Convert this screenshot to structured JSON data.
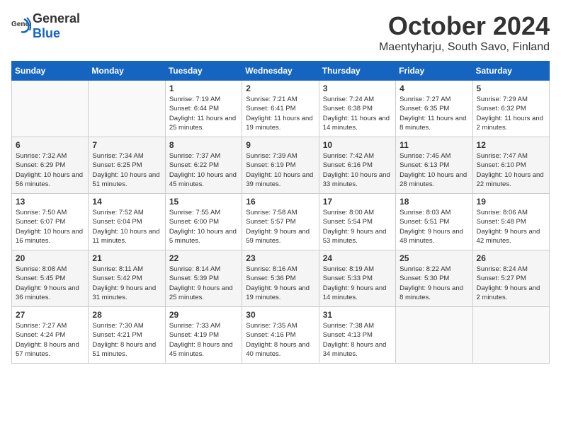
{
  "header": {
    "logo_general": "General",
    "logo_blue": "Blue",
    "month_title": "October 2024",
    "location": "Maentyharju, South Savo, Finland"
  },
  "weekdays": [
    "Sunday",
    "Monday",
    "Tuesday",
    "Wednesday",
    "Thursday",
    "Friday",
    "Saturday"
  ],
  "weeks": [
    [
      {
        "day": "",
        "sunrise": "",
        "sunset": "",
        "daylight": ""
      },
      {
        "day": "",
        "sunrise": "",
        "sunset": "",
        "daylight": ""
      },
      {
        "day": "1",
        "sunrise": "Sunrise: 7:19 AM",
        "sunset": "Sunset: 6:44 PM",
        "daylight": "Daylight: 11 hours and 25 minutes."
      },
      {
        "day": "2",
        "sunrise": "Sunrise: 7:21 AM",
        "sunset": "Sunset: 6:41 PM",
        "daylight": "Daylight: 11 hours and 19 minutes."
      },
      {
        "day": "3",
        "sunrise": "Sunrise: 7:24 AM",
        "sunset": "Sunset: 6:38 PM",
        "daylight": "Daylight: 11 hours and 14 minutes."
      },
      {
        "day": "4",
        "sunrise": "Sunrise: 7:27 AM",
        "sunset": "Sunset: 6:35 PM",
        "daylight": "Daylight: 11 hours and 8 minutes."
      },
      {
        "day": "5",
        "sunrise": "Sunrise: 7:29 AM",
        "sunset": "Sunset: 6:32 PM",
        "daylight": "Daylight: 11 hours and 2 minutes."
      }
    ],
    [
      {
        "day": "6",
        "sunrise": "Sunrise: 7:32 AM",
        "sunset": "Sunset: 6:29 PM",
        "daylight": "Daylight: 10 hours and 56 minutes."
      },
      {
        "day": "7",
        "sunrise": "Sunrise: 7:34 AM",
        "sunset": "Sunset: 6:25 PM",
        "daylight": "Daylight: 10 hours and 51 minutes."
      },
      {
        "day": "8",
        "sunrise": "Sunrise: 7:37 AM",
        "sunset": "Sunset: 6:22 PM",
        "daylight": "Daylight: 10 hours and 45 minutes."
      },
      {
        "day": "9",
        "sunrise": "Sunrise: 7:39 AM",
        "sunset": "Sunset: 6:19 PM",
        "daylight": "Daylight: 10 hours and 39 minutes."
      },
      {
        "day": "10",
        "sunrise": "Sunrise: 7:42 AM",
        "sunset": "Sunset: 6:16 PM",
        "daylight": "Daylight: 10 hours and 33 minutes."
      },
      {
        "day": "11",
        "sunrise": "Sunrise: 7:45 AM",
        "sunset": "Sunset: 6:13 PM",
        "daylight": "Daylight: 10 hours and 28 minutes."
      },
      {
        "day": "12",
        "sunrise": "Sunrise: 7:47 AM",
        "sunset": "Sunset: 6:10 PM",
        "daylight": "Daylight: 10 hours and 22 minutes."
      }
    ],
    [
      {
        "day": "13",
        "sunrise": "Sunrise: 7:50 AM",
        "sunset": "Sunset: 6:07 PM",
        "daylight": "Daylight: 10 hours and 16 minutes."
      },
      {
        "day": "14",
        "sunrise": "Sunrise: 7:52 AM",
        "sunset": "Sunset: 6:04 PM",
        "daylight": "Daylight: 10 hours and 11 minutes."
      },
      {
        "day": "15",
        "sunrise": "Sunrise: 7:55 AM",
        "sunset": "Sunset: 6:00 PM",
        "daylight": "Daylight: 10 hours and 5 minutes."
      },
      {
        "day": "16",
        "sunrise": "Sunrise: 7:58 AM",
        "sunset": "Sunset: 5:57 PM",
        "daylight": "Daylight: 9 hours and 59 minutes."
      },
      {
        "day": "17",
        "sunrise": "Sunrise: 8:00 AM",
        "sunset": "Sunset: 5:54 PM",
        "daylight": "Daylight: 9 hours and 53 minutes."
      },
      {
        "day": "18",
        "sunrise": "Sunrise: 8:03 AM",
        "sunset": "Sunset: 5:51 PM",
        "daylight": "Daylight: 9 hours and 48 minutes."
      },
      {
        "day": "19",
        "sunrise": "Sunrise: 8:06 AM",
        "sunset": "Sunset: 5:48 PM",
        "daylight": "Daylight: 9 hours and 42 minutes."
      }
    ],
    [
      {
        "day": "20",
        "sunrise": "Sunrise: 8:08 AM",
        "sunset": "Sunset: 5:45 PM",
        "daylight": "Daylight: 9 hours and 36 minutes."
      },
      {
        "day": "21",
        "sunrise": "Sunrise: 8:11 AM",
        "sunset": "Sunset: 5:42 PM",
        "daylight": "Daylight: 9 hours and 31 minutes."
      },
      {
        "day": "22",
        "sunrise": "Sunrise: 8:14 AM",
        "sunset": "Sunset: 5:39 PM",
        "daylight": "Daylight: 9 hours and 25 minutes."
      },
      {
        "day": "23",
        "sunrise": "Sunrise: 8:16 AM",
        "sunset": "Sunset: 5:36 PM",
        "daylight": "Daylight: 9 hours and 19 minutes."
      },
      {
        "day": "24",
        "sunrise": "Sunrise: 8:19 AM",
        "sunset": "Sunset: 5:33 PM",
        "daylight": "Daylight: 9 hours and 14 minutes."
      },
      {
        "day": "25",
        "sunrise": "Sunrise: 8:22 AM",
        "sunset": "Sunset: 5:30 PM",
        "daylight": "Daylight: 9 hours and 8 minutes."
      },
      {
        "day": "26",
        "sunrise": "Sunrise: 8:24 AM",
        "sunset": "Sunset: 5:27 PM",
        "daylight": "Daylight: 9 hours and 2 minutes."
      }
    ],
    [
      {
        "day": "27",
        "sunrise": "Sunrise: 7:27 AM",
        "sunset": "Sunset: 4:24 PM",
        "daylight": "Daylight: 8 hours and 57 minutes."
      },
      {
        "day": "28",
        "sunrise": "Sunrise: 7:30 AM",
        "sunset": "Sunset: 4:21 PM",
        "daylight": "Daylight: 8 hours and 51 minutes."
      },
      {
        "day": "29",
        "sunrise": "Sunrise: 7:33 AM",
        "sunset": "Sunset: 4:19 PM",
        "daylight": "Daylight: 8 hours and 45 minutes."
      },
      {
        "day": "30",
        "sunrise": "Sunrise: 7:35 AM",
        "sunset": "Sunset: 4:16 PM",
        "daylight": "Daylight: 8 hours and 40 minutes."
      },
      {
        "day": "31",
        "sunrise": "Sunrise: 7:38 AM",
        "sunset": "Sunset: 4:13 PM",
        "daylight": "Daylight: 8 hours and 34 minutes."
      },
      {
        "day": "",
        "sunrise": "",
        "sunset": "",
        "daylight": ""
      },
      {
        "day": "",
        "sunrise": "",
        "sunset": "",
        "daylight": ""
      }
    ]
  ]
}
